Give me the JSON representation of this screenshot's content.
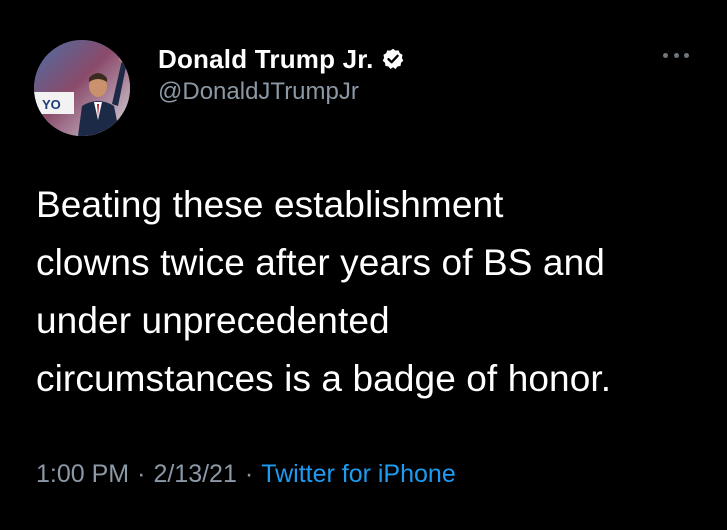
{
  "author": {
    "display_name": "Donald Trump Jr.",
    "handle": "@DonaldJTrumpJr",
    "verified": true,
    "avatar_sign_text": "YO"
  },
  "tweet": {
    "lines": [
      "Beating these establishment",
      "clowns twice after years of BS and",
      "under unprecedented",
      "circumstances is a badge of honor."
    ]
  },
  "meta": {
    "time": "1:00 PM",
    "separator": "·",
    "date": "2/13/21",
    "source": "Twitter for iPhone"
  },
  "icons": {
    "more": "more-horizontal-icon",
    "verified": "verified-badge-icon"
  },
  "colors": {
    "background": "#000000",
    "text_primary": "#ffffff",
    "text_secondary": "#8b98a5",
    "link": "#1d9bf0"
  }
}
